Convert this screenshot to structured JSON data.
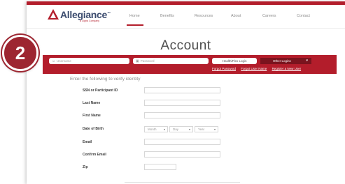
{
  "header": {
    "logo": {
      "name": "Allegiance",
      "tagline": "a Cigna Company"
    },
    "nav": [
      "Home",
      "Benefits",
      "Resources",
      "About",
      "Careers",
      "Contact"
    ],
    "active_nav": "Home"
  },
  "step_badge": "2",
  "page_title": "Account",
  "login_bar": {
    "username_placeholder": "Username",
    "password_placeholder": "Password",
    "login_button": "Health/Flex Login",
    "other_logins": "Other Logins",
    "links": [
      "Forgot Password",
      "Forgot User Name",
      "Register a New User"
    ]
  },
  "verify": {
    "heading": "Enter the following to verify identity",
    "fields": {
      "ssn": "SSN or Participant ID",
      "last_name": "Last Name",
      "first_name": "First Name",
      "dob": "Date of Birth",
      "email": "Email",
      "confirm_email": "Confirm Email",
      "zip": "Zip"
    },
    "dob_selects": {
      "month": "Month",
      "day": "Day",
      "year": "Year"
    }
  },
  "colors": {
    "brand_red": "#b31d2b",
    "dark_red": "#7a141e",
    "badge_red": "#9d2631"
  },
  "icons": {
    "username": "person-icon",
    "password": "lock-icon",
    "logo": "triangle-logo-icon",
    "select": "chevron-down-icon"
  }
}
